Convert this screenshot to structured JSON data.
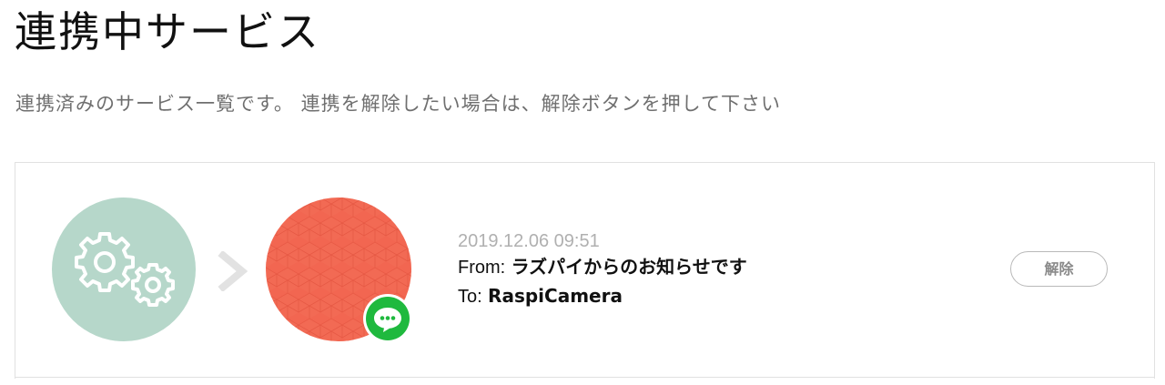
{
  "header": {
    "title": "連携中サービス",
    "description": "連携済みのサービス一覧です。 連携を解除したい場合は、解除ボタンを押して下さい"
  },
  "services": [
    {
      "date": "2019.12.06 09:51",
      "from_label": "From:",
      "from_value": "ラズパイからのお知らせです",
      "to_label": "To:",
      "to_value": "RaspiCamera",
      "release_label": "解除",
      "provider_icon": "gears-icon",
      "channel_icon": "line-chat-icon",
      "arrow_icon": "chevron-right-icon"
    }
  ],
  "colors": {
    "provider_circle": "#b6d7ca",
    "channel_circle": "#f26a54",
    "line_badge": "#1fb93e",
    "date_text": "#b0b0b0",
    "description_text": "#6f6f6f",
    "button_border": "#b9b9b9"
  }
}
